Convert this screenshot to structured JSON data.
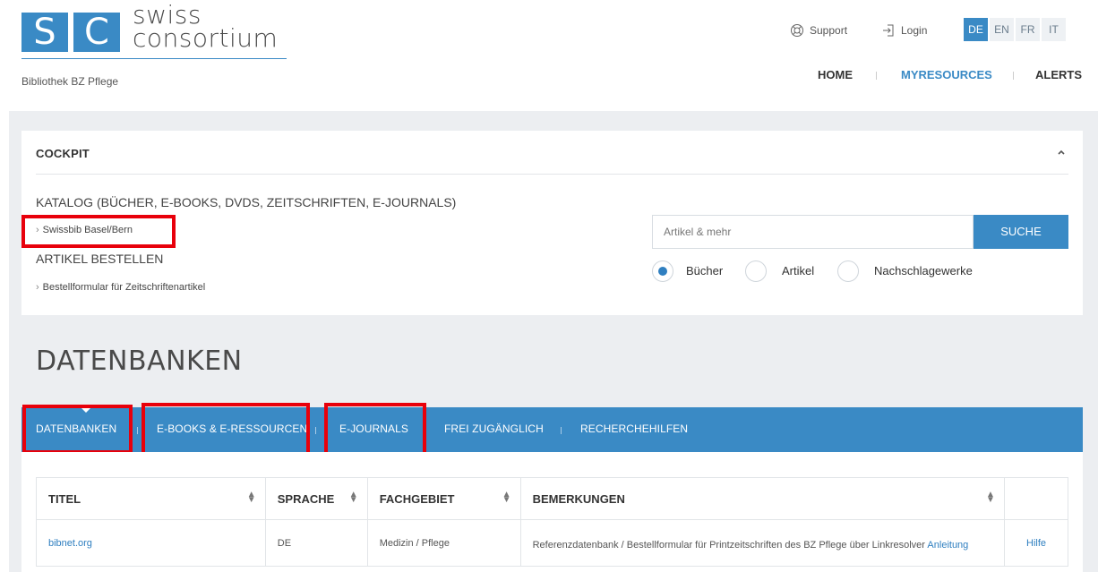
{
  "header": {
    "logo": {
      "letter1": "S",
      "letter2": "C",
      "text_line1": "swiss",
      "text_line2": "consortium"
    },
    "library_name": "Bibliothek BZ Pflege",
    "support_label": "Support",
    "login_label": "Login",
    "languages": [
      "DE",
      "EN",
      "FR",
      "IT"
    ],
    "active_language": "DE",
    "nav": {
      "home": "HOME",
      "myresources": "MYRESOURCES",
      "alerts": "ALERTS"
    }
  },
  "cockpit": {
    "title": "COCKPIT",
    "katalog_heading": "KATALOG (BÜCHER, E-BOOKS, DVDS, ZEITSCHRIFTEN, E-JOURNALS)",
    "katalog_link": "Swissbib Basel/Bern",
    "artikel_heading": "ARTIKEL BESTELLEN",
    "artikel_link": "Bestellformular für Zeitschriftenartikel",
    "search": {
      "placeholder": "Artikel & mehr",
      "button": "SUCHE"
    },
    "radios": [
      {
        "label": "Bücher",
        "checked": true
      },
      {
        "label": "Artikel",
        "checked": false
      },
      {
        "label": "Nachschlagewerke",
        "checked": false
      }
    ]
  },
  "databases": {
    "title": "DATENBANKEN",
    "tabs": [
      "DATENBANKEN",
      "E-BOOKS & E-RESSOURCEN",
      "E-JOURNALS",
      "FREI ZUGÄNGLICH",
      "RECHERCHEHILFEN"
    ],
    "table": {
      "headers": [
        "TITEL",
        "SPRACHE",
        "FACHGEBIET",
        "BEMERKUNGEN",
        ""
      ],
      "rows": [
        {
          "title": "bibnet.org",
          "language": "DE",
          "field": "Medizin / Pflege",
          "remark_text": "Referenzdatenbank / Bestellformular für Printzeitschriften des BZ Pflege über Linkresolver",
          "remark_link": "Anleitung",
          "help": "Hilfe"
        }
      ]
    }
  },
  "colors": {
    "accent": "#3a8ac5",
    "highlight": "#e8000b",
    "background": "#eceef1"
  }
}
